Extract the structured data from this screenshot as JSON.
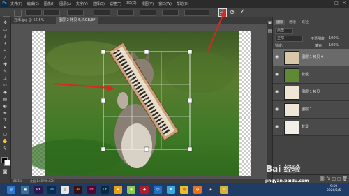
{
  "app": {
    "logo_text": "Ps"
  },
  "menubar": {
    "items": [
      "文件(F)",
      "编辑(E)",
      "图像(I)",
      "图层(L)",
      "文字(Y)",
      "选择(S)",
      "滤镜(T)",
      "3D(D)",
      "视图(V)",
      "窗口(W)",
      "帮助(H)"
    ]
  },
  "window_buttons": {
    "minimize": "–",
    "maximize": "□",
    "close": "×"
  },
  "tabs": [
    {
      "label": "万米.jpg @ 66.5%",
      "active": false
    },
    {
      "label": "图层 2 拷贝 6, RGB/8*",
      "active": true
    }
  ],
  "status": {
    "zoom": "66.5%",
    "doc_info": "文档:1.65M/8.62M"
  },
  "panel": {
    "tabs": [
      "图层",
      "通道",
      "路径"
    ],
    "filter_label": "类型",
    "blend_mode": "正常",
    "opacity_label": "不透明度:",
    "opacity_value": "100%",
    "lock_label": "锁定:",
    "fill_label": "填充:",
    "fill_value": "100%"
  },
  "layers": [
    {
      "name": "图层 1 拷贝 4",
      "selected": true
    },
    {
      "name": "松鼠",
      "selected": false
    },
    {
      "name": "图层 1 拷贝",
      "selected": false
    },
    {
      "name": "图层 1",
      "selected": false
    },
    {
      "name": "背景",
      "selected": false
    }
  ],
  "tray": {
    "time": "9:59",
    "date": "2020/5/5"
  },
  "watermark": {
    "brand": "Bai 经验",
    "url": "jingyan.baidu.com"
  },
  "icons": {
    "warp": "warp-mode-icon",
    "cancel": "cancel-transform-icon",
    "commit": "commit-transform-icon"
  },
  "colors": {
    "annotation_arrow": "#d42a22",
    "accent": "#31a8ff"
  }
}
